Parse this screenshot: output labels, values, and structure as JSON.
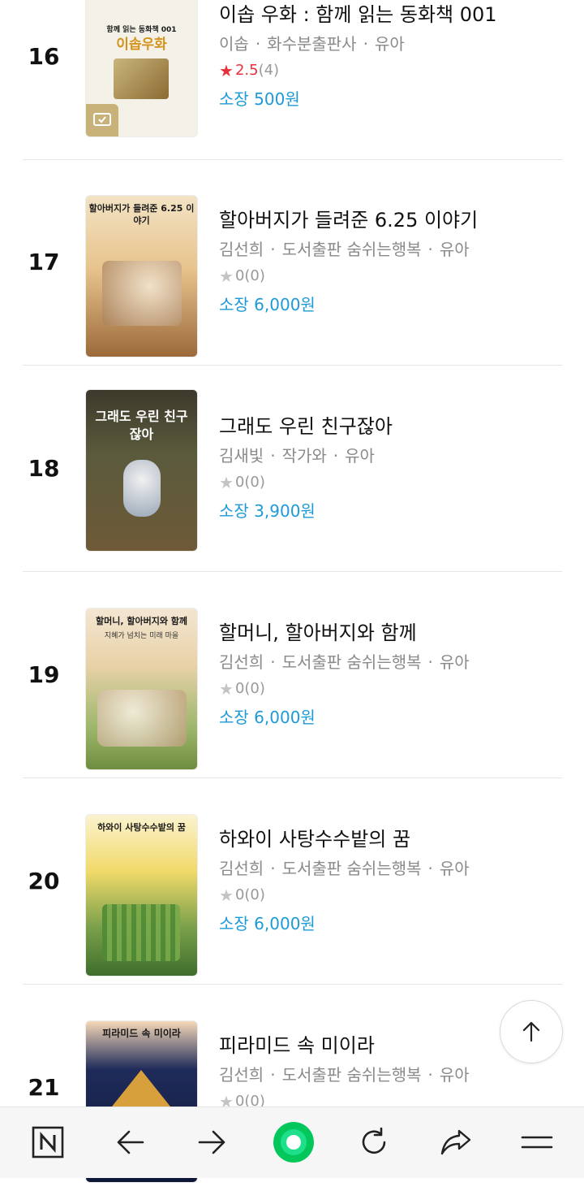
{
  "books": [
    {
      "rank": "16",
      "title": "이솝 우화 : 함께 읽는 동화책 001",
      "author": "이솝",
      "publisher": "화수분출판사",
      "category": "유아",
      "rating": "2.5",
      "rating_count": "(4)",
      "price": "소장 500원",
      "cover": {
        "title": "이솝우화",
        "subtitle": "함께 읽는 동화책 001"
      }
    },
    {
      "rank": "17",
      "title": "할아버지가 들려준 6.25 이야기",
      "author": "김선희",
      "publisher": "도서출판 숨쉬는행복",
      "category": "유아",
      "rating": "0",
      "rating_count": "(0)",
      "price": "소장 6,000원",
      "cover": {
        "title": "할아버지가 들려준 6.25 이야기"
      }
    },
    {
      "rank": "18",
      "title": "그래도 우린 친구잖아",
      "author": "김새빛",
      "publisher": "작가와",
      "category": "유아",
      "rating": "0",
      "rating_count": "(0)",
      "price": "소장 3,900원",
      "cover": {
        "title": "그래도 우린 친구잖아"
      }
    },
    {
      "rank": "19",
      "title": "할머니, 할아버지와 함께",
      "author": "김선희",
      "publisher": "도서출판 숨쉬는행복",
      "category": "유아",
      "rating": "0",
      "rating_count": "(0)",
      "price": "소장 6,000원",
      "cover": {
        "title": "할머니, 할아버지와 함께",
        "subtitle": "지혜가 넘치는 미래 마을"
      }
    },
    {
      "rank": "20",
      "title": "하와이 사탕수수밭의 꿈",
      "author": "김선희",
      "publisher": "도서출판 숨쉬는행복",
      "category": "유아",
      "rating": "0",
      "rating_count": "(0)",
      "price": "소장 6,000원",
      "cover": {
        "title": "하와이 사탕수수밭의 꿈"
      }
    },
    {
      "rank": "21",
      "title": "피라미드 속 미이라",
      "author": "김선희",
      "publisher": "도서출판 숨쉬는행복",
      "category": "유아",
      "rating": "0",
      "rating_count": "(0)",
      "price": "",
      "cover": {
        "title": "피라미드 속 미이라"
      }
    }
  ],
  "separator": "·",
  "star_glyph": "★",
  "icons": {
    "scroll_top": "arrow-up-icon",
    "nav": [
      "naver-n-icon",
      "back-arrow-icon",
      "forward-arrow-icon",
      "home-green-circle-icon",
      "refresh-icon",
      "share-icon",
      "menu-icon"
    ]
  },
  "colors": {
    "price": "#1e9ad6",
    "rating_hot": "#e8303a",
    "accent_green": "#03c75a"
  }
}
